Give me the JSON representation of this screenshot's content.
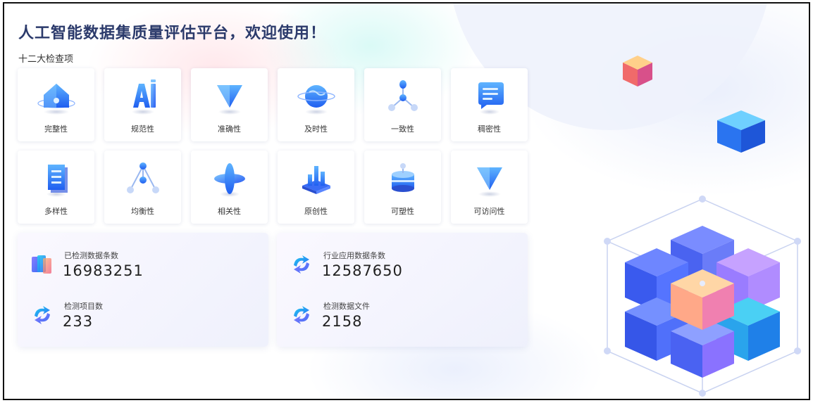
{
  "header": {
    "title": "人工智能数据集质量评估平台，欢迎使用！",
    "section_title": "十二大检查项"
  },
  "check_items": [
    {
      "label": "完整性",
      "icon": "house-icon"
    },
    {
      "label": "规范性",
      "icon": "ai-icon"
    },
    {
      "label": "准确性",
      "icon": "triangle-icon"
    },
    {
      "label": "及时性",
      "icon": "globe-icon"
    },
    {
      "label": "一致性",
      "icon": "molecule-icon"
    },
    {
      "label": "稠密性",
      "icon": "message-icon"
    },
    {
      "label": "多样性",
      "icon": "document-icon"
    },
    {
      "label": "均衡性",
      "icon": "balance-icon"
    },
    {
      "label": "相关性",
      "icon": "diamond-icon"
    },
    {
      "label": "原创性",
      "icon": "bars-icon"
    },
    {
      "label": "可塑性",
      "icon": "database-icon"
    },
    {
      "label": "可访问性",
      "icon": "triangle-icon"
    }
  ],
  "stats": {
    "detected_records_label": "已检测数据条数",
    "detected_records_value": "16983251",
    "industry_records_label": "行业应用数据条数",
    "industry_records_value": "12587650",
    "projects_label": "检测项目数",
    "projects_value": "233",
    "files_label": "检测数据文件",
    "files_value": "2158"
  },
  "colors": {
    "title": "#2b3a6b",
    "accent_blue": "#2f6bff",
    "accent_cyan": "#22c3e6"
  }
}
